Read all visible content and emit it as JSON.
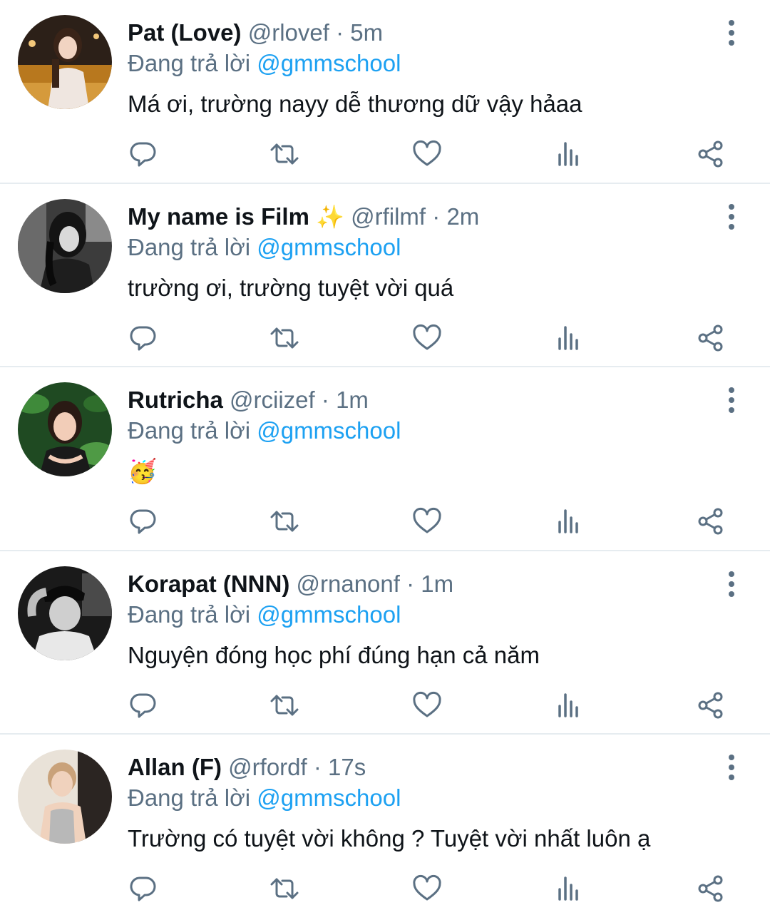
{
  "colors": {
    "text": "#0f1419",
    "secondary": "#5b7083",
    "mention": "#1da1f2",
    "divider": "#e6ecf0"
  },
  "tweets": [
    {
      "name": "Pat (Love)",
      "name_emoji": "",
      "handle": "@rlovef",
      "time": "5m",
      "reply_prefix": "Đang trả lời",
      "reply_to": "@gmmschool",
      "text": "Má ơi, trường nayy dễ thương dữ vậy hảaa",
      "avatar_icon": "woman-city-night-photo"
    },
    {
      "name": "My name is Film",
      "name_emoji": "✨",
      "handle": "@rfilmf",
      "time": "2m",
      "reply_prefix": "Đang trả lời",
      "reply_to": "@gmmschool",
      "text": "trường ơi, trường tuyệt vời quá",
      "avatar_icon": "woman-monochrome-photo"
    },
    {
      "name": "Rutricha",
      "name_emoji": "",
      "handle": "@rciizef",
      "time": "1m",
      "reply_prefix": "Đang trả lời",
      "reply_to": "@gmmschool",
      "text": "🥳",
      "avatar_icon": "woman-leaves-photo"
    },
    {
      "name": "Korapat (NNN)",
      "name_emoji": "",
      "handle": "@rnanonf",
      "time": "1m",
      "reply_prefix": "Đang trả lời",
      "reply_to": "@gmmschool",
      "text": "Nguyện đóng học phí đúng hạn cả năm",
      "avatar_icon": "man-cap-monochrome-photo"
    },
    {
      "name": "Allan (F)",
      "name_emoji": "",
      "handle": "@rfordf",
      "time": "17s",
      "reply_prefix": "Đang trả lời",
      "reply_to": "@gmmschool",
      "text": "Trường có tuyệt vời không ? Tuyệt vời nhất luôn ạ",
      "avatar_icon": "man-white-tank-photo"
    }
  ],
  "action_icons": [
    "reply-icon",
    "retweet-icon",
    "like-icon",
    "analytics-icon",
    "share-icon"
  ]
}
